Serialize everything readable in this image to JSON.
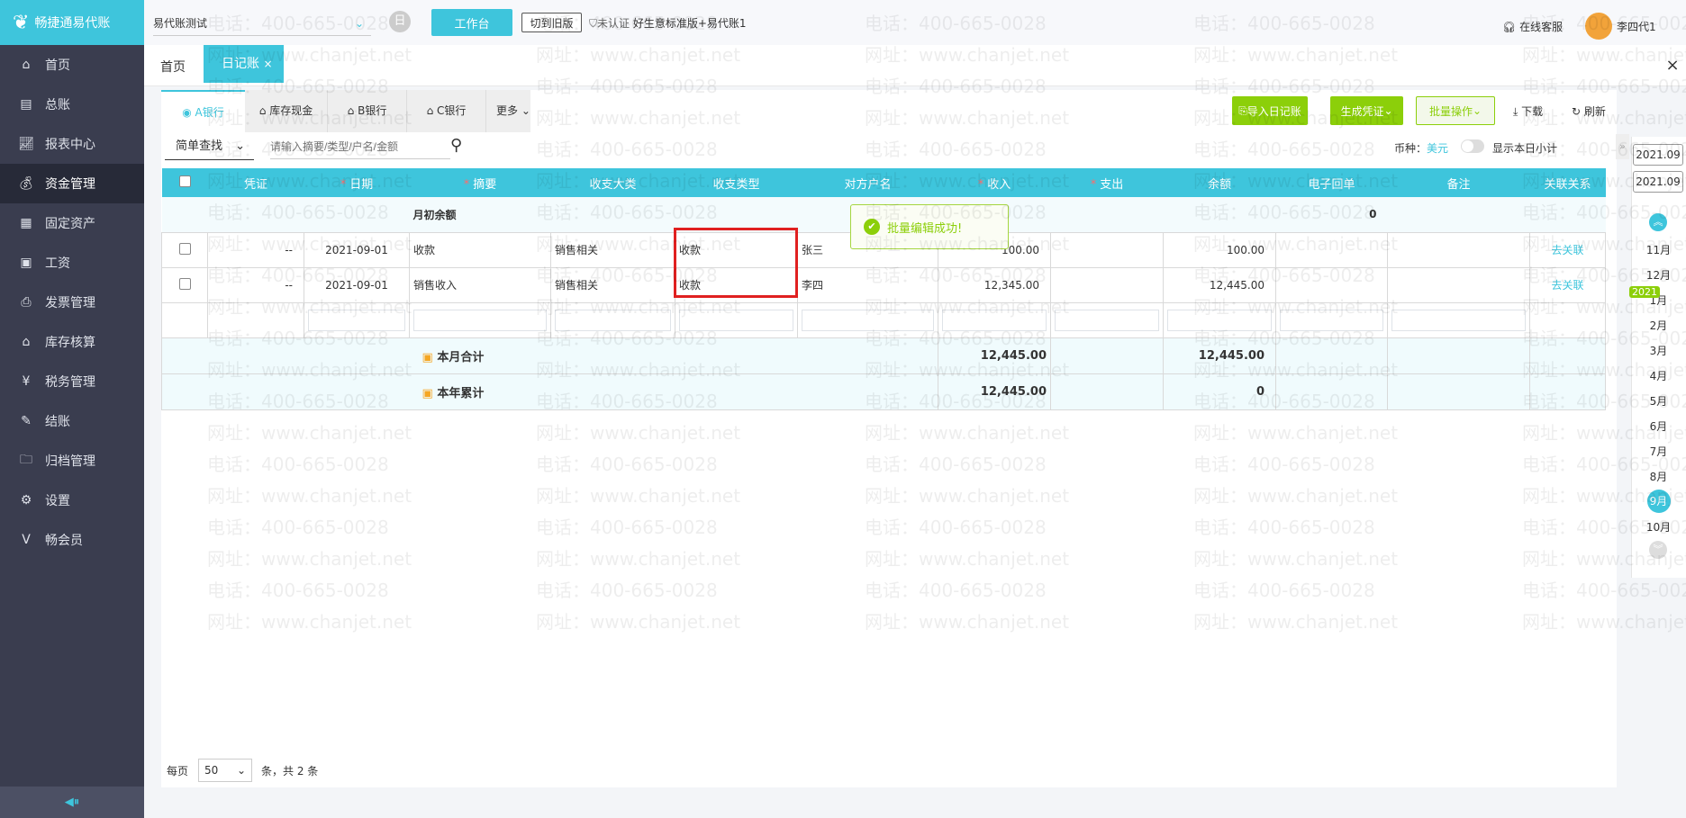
{
  "app": {
    "name": "畅捷通易代账",
    "collapse_icon": "collapse-arrow-icon"
  },
  "sidebar": {
    "items": [
      {
        "label": "首页",
        "icon": "home-icon"
      },
      {
        "label": "总账",
        "icon": "ledger-icon"
      },
      {
        "label": "报表中心",
        "icon": "chart-icon"
      },
      {
        "label": "资金管理",
        "icon": "money-bag-icon",
        "active": true
      },
      {
        "label": "固定资产",
        "icon": "asset-icon"
      },
      {
        "label": "工资",
        "icon": "salary-icon"
      },
      {
        "label": "发票管理",
        "icon": "invoice-icon"
      },
      {
        "label": "库存核算",
        "icon": "warehouse-icon"
      },
      {
        "label": "税务管理",
        "icon": "tax-icon"
      },
      {
        "label": "结账",
        "icon": "checkout-icon"
      },
      {
        "label": "归档管理",
        "icon": "archive-icon"
      },
      {
        "label": "设置",
        "icon": "gear-icon"
      },
      {
        "label": "畅会员",
        "icon": "vip-icon"
      }
    ]
  },
  "topbar": {
    "company": "易代账测试",
    "workbench": "工作台",
    "switch_old": "切到旧版",
    "unverified": "未认证",
    "edition": "好生意标准版+易代账1",
    "support": "在线客服",
    "user": "李四代1"
  },
  "tabs": [
    {
      "label": "首页"
    },
    {
      "label": "日记账",
      "active": true
    }
  ],
  "accounts": {
    "tabs": [
      "A银行",
      "库存现金",
      "B银行",
      "C银行"
    ],
    "more": "更多"
  },
  "actions": {
    "import": "导入日记账",
    "voucher": "生成凭证",
    "batch": "批量操作",
    "download": "下载",
    "refresh": "刷新"
  },
  "search": {
    "mode": "简单查找",
    "placeholder": "请输入摘要/类型/户名/金额",
    "currency_label": "币种：",
    "currency": "美元",
    "daily_subtotal": "显示本日小计",
    "daily_subtotal_on": false
  },
  "table": {
    "headers": [
      "凭证",
      "日期",
      "摘要",
      "收支大类",
      "收支类型",
      "对方户名",
      "收入",
      "支出",
      "余额",
      "电子回单",
      "备注",
      "关联关系"
    ],
    "required": [
      false,
      true,
      true,
      false,
      false,
      false,
      true,
      true,
      false,
      false,
      false,
      false
    ],
    "opening": {
      "label": "月初余额",
      "balance": "0"
    },
    "rows": [
      {
        "voucher": "--",
        "date": "2021-09-01",
        "summary": "收款",
        "category": "销售相关",
        "type": "收款",
        "party": "张三",
        "income": "100.00",
        "expense": "",
        "balance": "100.00",
        "receipt": "",
        "note": "",
        "relation": "去关联"
      },
      {
        "voucher": "--",
        "date": "2021-09-01",
        "summary": "销售收入",
        "category": "销售相关",
        "type": "收款",
        "party": "李四",
        "income": "12,345.00",
        "expense": "",
        "balance": "12,445.00",
        "receipt": "",
        "note": "",
        "relation": "去关联"
      }
    ],
    "month_total": {
      "label": "本月合计",
      "income": "12,445.00",
      "balance": "12,445.00"
    },
    "year_total": {
      "label": "本年累计",
      "income": "12,445.00",
      "balance": "0"
    }
  },
  "toast": "批量编辑成功!",
  "pagination": {
    "per_page_label": "每页",
    "per_page": "50",
    "total": "条，共 2 条"
  },
  "dates": {
    "start": "2021.09",
    "end": "2021.09",
    "year_badge": "2021",
    "months": [
      "11月",
      "12月",
      "1月",
      "2月",
      "3月",
      "4月",
      "5月",
      "6月",
      "7月",
      "8月",
      "9月",
      "10月"
    ],
    "selected": "9月"
  },
  "watermark": [
    "电话：400-665-0028",
    "网址：www.chanjet.net"
  ],
  "colors": {
    "primary": "#3ec5dc",
    "green": "#8ccf0a",
    "sidebar": "#3a3d4f",
    "highlight": "#e02020"
  }
}
